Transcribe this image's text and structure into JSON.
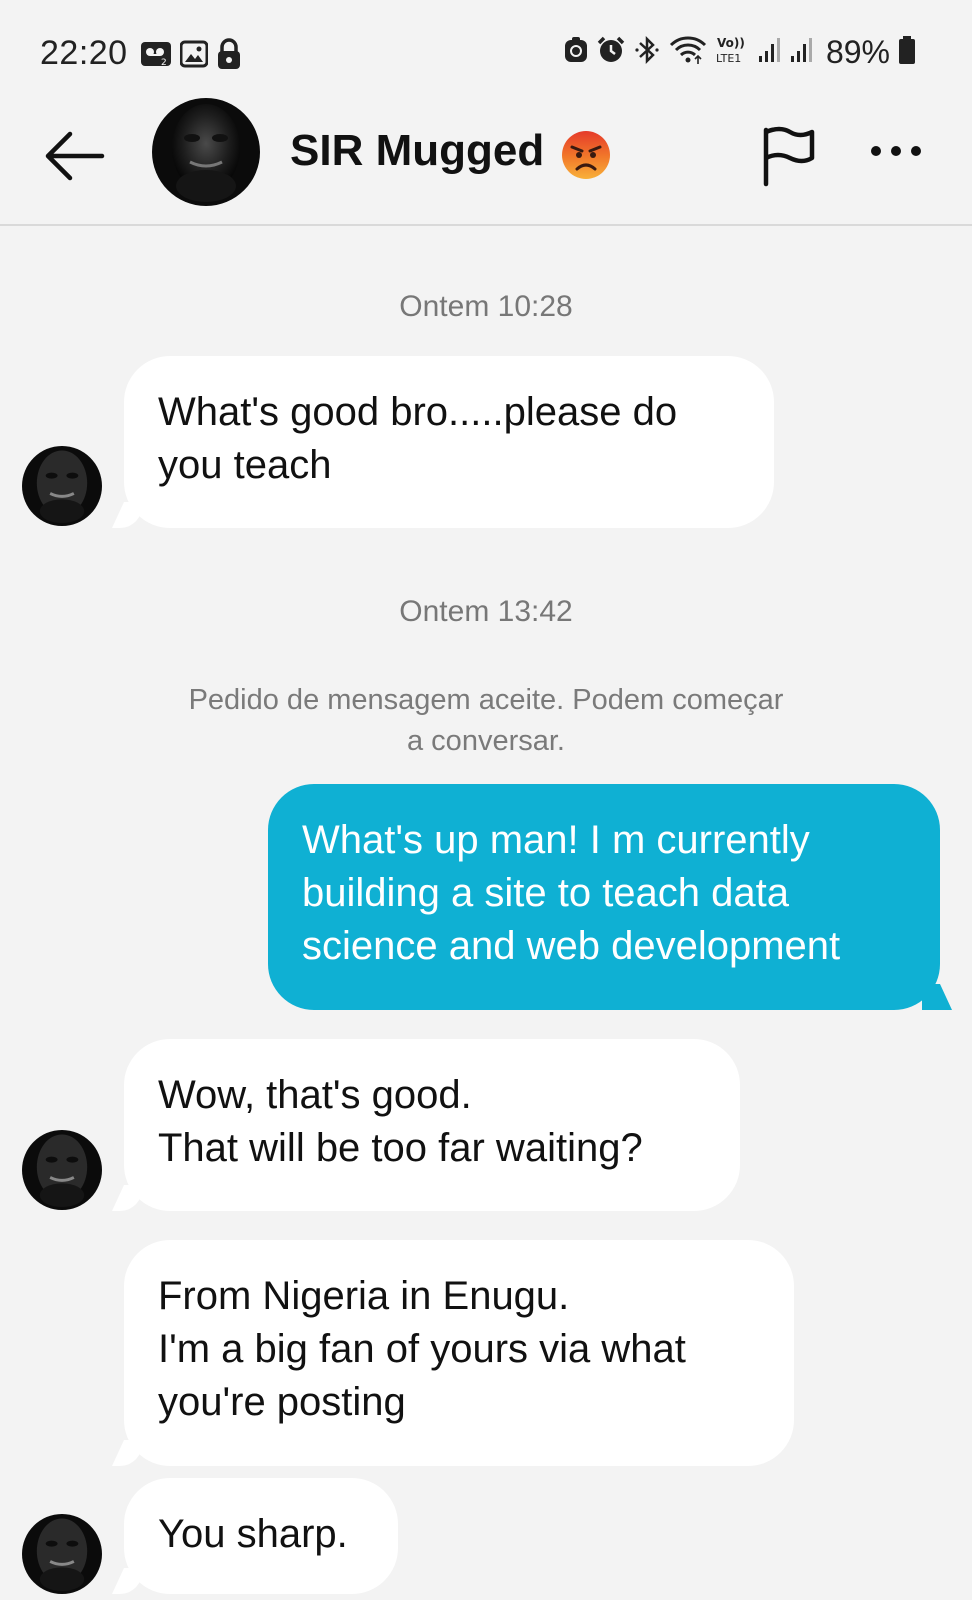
{
  "status_bar": {
    "time": "22:20",
    "battery": "89%"
  },
  "header": {
    "contact_name": "SIR Mugged"
  },
  "chat": {
    "timestamp_1": "Ontem 10:28",
    "msg_1": "What's good bro.....please do\nyou teach",
    "timestamp_2": "Ontem 13:42",
    "system_note": "Pedido de mensagem aceite. Podem começar\na conversar.",
    "msg_2": "What's up man! I m currently\nbuilding a site to teach data\nscience and web development",
    "msg_3": "Wow, that's good.\nThat will be too far waiting?",
    "msg_4": "From Nigeria in Enugu.\nI'm a big fan of yours via what\nyou're posting",
    "msg_5": "You sharp."
  },
  "colors": {
    "outgoing_bubble": "#0fb0d3",
    "incoming_bubble": "#ffffff",
    "background": "#f3f3f3"
  },
  "icons": [
    "voicemail-icon",
    "gallery-icon",
    "lock-icon",
    "app-icon",
    "alarm-icon",
    "bluetooth-icon",
    "wifi-icon",
    "volte-icon",
    "signal-icon",
    "battery-icon",
    "back-arrow-icon",
    "angry-face-emoji",
    "flag-icon",
    "more-icon"
  ]
}
